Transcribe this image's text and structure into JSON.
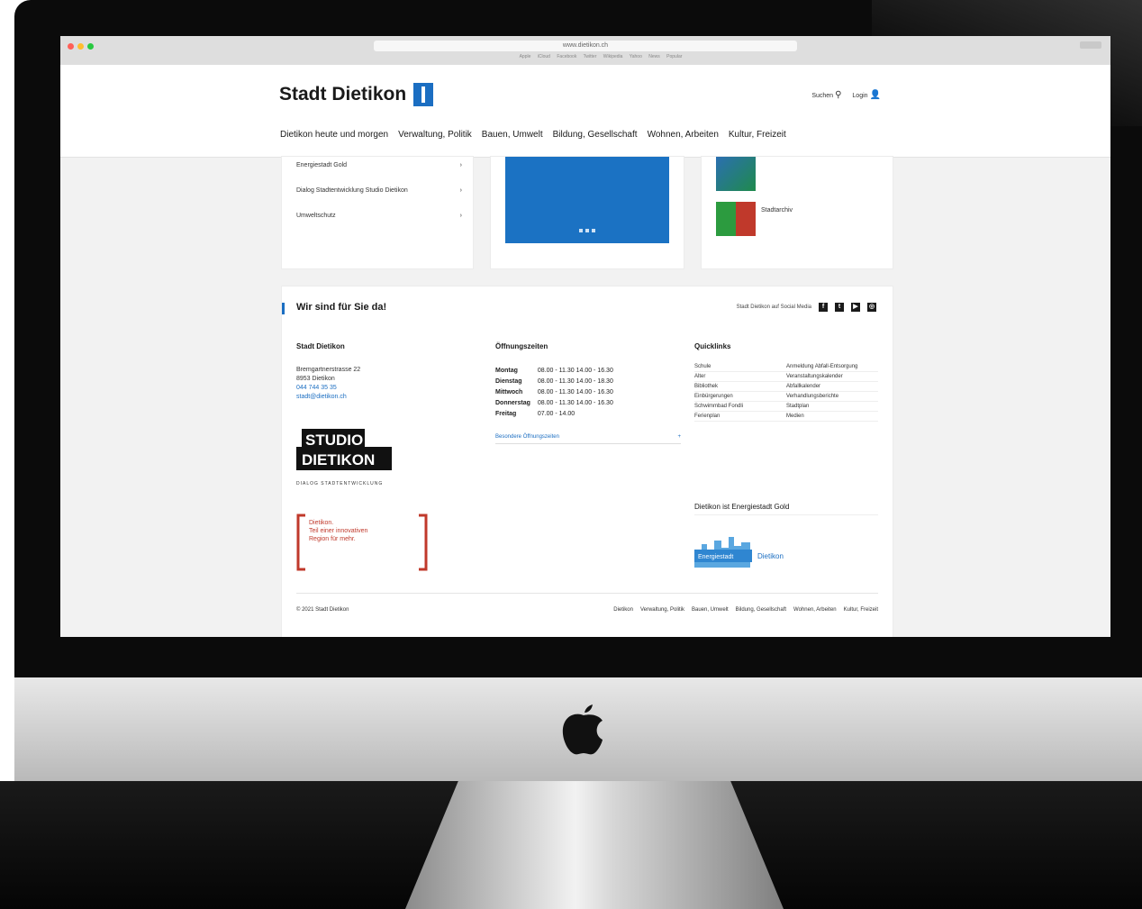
{
  "browser": {
    "url": "www.dietikon.ch",
    "bookmarks": [
      "Apple",
      "iCloud",
      "Facebook",
      "Twitter",
      "Wikipedia",
      "Yahoo",
      "News",
      "Popular"
    ]
  },
  "site": {
    "brand": "Stadt Dietikon",
    "search_label": "Suchen",
    "login_label": "Login",
    "nav": [
      "Dietikon heute und morgen",
      "Verwaltung, Politik",
      "Bauen, Umwelt",
      "Bildung, Gesellschaft",
      "Wohnen, Arbeiten",
      "Kultur, Freizeit"
    ]
  },
  "cards": {
    "links": [
      {
        "label": "Energiestadt Gold",
        "arrow": "›"
      },
      {
        "label": "Dialog Stadtentwicklung Studio Dietikon",
        "arrow": "›"
      },
      {
        "label": "Umweltschutz",
        "arrow": "›"
      }
    ],
    "thumb_label": "Stadtarchiv"
  },
  "footer": {
    "title": "Wir sind für Sie da!",
    "social_label": "Stadt Dietikon auf Social Media",
    "social_icons": [
      "f",
      "t",
      "▶",
      "◎"
    ],
    "address": {
      "head": "Stadt Dietikon",
      "street": "Bremgartnerstrasse 22",
      "city": "8953 Dietikon",
      "phone": "044 744 35 35",
      "email": "stadt@dietikon.ch"
    },
    "studio": {
      "line1": "STUDIO",
      "line2": "DIETIKON",
      "sub": "DIALOG STADTENTWICKLUNG"
    },
    "slogan": [
      "Dietikon.",
      "Teil einer innovativen",
      "Region für mehr."
    ],
    "hours": {
      "head": "Öffnungszeiten",
      "rows": [
        {
          "day": "Montag",
          "times": "08.00 - 11.30  14.00 - 16.30"
        },
        {
          "day": "Dienstag",
          "times": "08.00 - 11.30  14.00 - 18.30"
        },
        {
          "day": "Mittwoch",
          "times": "08.00 - 11.30  14.00 - 16.30"
        },
        {
          "day": "Donnerstag",
          "times": "08.00 - 11.30  14.00 - 16.30"
        },
        {
          "day": "Freitag",
          "times": "07.00 - 14.00"
        }
      ],
      "more_link": "Besondere Öffnungszeiten",
      "more_icon": "+"
    },
    "quicklinks": {
      "head": "Quicklinks",
      "rows": [
        [
          "Schule",
          "Anmeldung Abfall-Entsorgung"
        ],
        [
          "Alter",
          "Veranstaltungskalender"
        ],
        [
          "Bibliothek",
          "Abfallkalender"
        ],
        [
          "Einbürgerungen",
          "Verhandlungsberichte"
        ],
        [
          "Schwimmbad Fondli",
          "Stadtplan"
        ],
        [
          "Ferienplan",
          "Medien"
        ]
      ]
    },
    "energy": {
      "head": "Dietikon ist Energiestadt Gold",
      "badge": "Energiestadt",
      "city": "Dietikon"
    },
    "copyright": "© 2021 Stadt Dietikon",
    "bottom_nav": [
      "Dietikon",
      "Verwaltung, Politik",
      "Bauen, Umwelt",
      "Bildung, Gesellschaft",
      "Wohnen, Arbeiten",
      "Kultur, Freizeit"
    ]
  },
  "colors": {
    "accent": "#1b6ec2",
    "slogan_red": "#c0392b"
  }
}
